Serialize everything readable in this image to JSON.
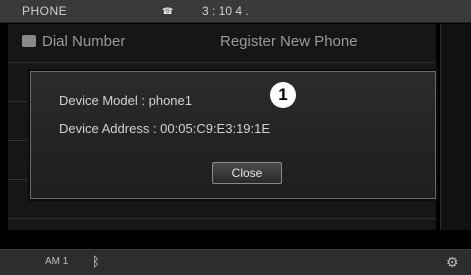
{
  "statusbar": {
    "title": "PHONE",
    "phone_icon": "☎",
    "time": "3 : 10 4 ."
  },
  "menu": {
    "items": [
      {
        "label": "Dial Number",
        "icon": "dialpad-icon"
      },
      {
        "label": "Register New Phone",
        "icon": ""
      }
    ]
  },
  "dialog": {
    "model_label": "Device Model",
    "model_value": ": phone1",
    "address_label": "Device Address",
    "address_value": ": 00:05:C9:E3:19:1E",
    "badge": "1",
    "close_label": "Close"
  },
  "bottombar": {
    "band": "AM 1",
    "bt_icon": "ᛒ",
    "gear": "⚙"
  }
}
